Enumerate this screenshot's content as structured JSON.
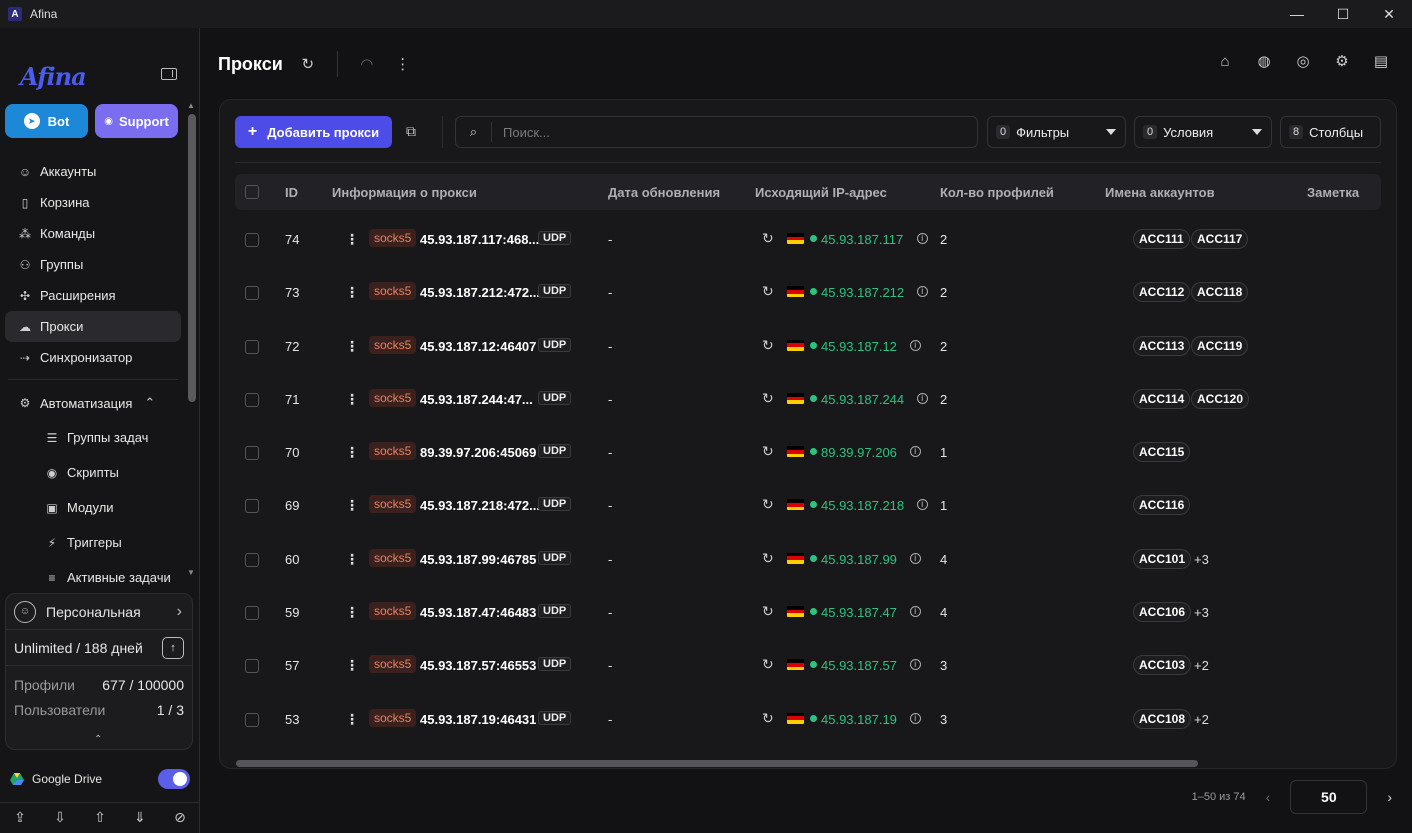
{
  "window": {
    "title": "Afina",
    "app_icon_letter": "A",
    "minimize": "—",
    "maximize": "☐",
    "close": "✕"
  },
  "brand": {
    "logo_text": "Afina"
  },
  "sidebar": {
    "bot_label": "Bot",
    "support_label": "Support",
    "items": [
      {
        "label": "Аккаунты",
        "icon": "user-circle-icon",
        "glyph": "☺"
      },
      {
        "label": "Корзина",
        "icon": "trash-icon",
        "glyph": "▯"
      },
      {
        "label": "Команды",
        "icon": "team-icon",
        "glyph": "⁂"
      },
      {
        "label": "Группы",
        "icon": "groups-icon",
        "glyph": "⚇"
      },
      {
        "label": "Расширения",
        "icon": "puzzle-icon",
        "glyph": "✣"
      },
      {
        "label": "Прокси",
        "icon": "cloud-icon",
        "glyph": "☁"
      },
      {
        "label": "Синхронизатор",
        "icon": "sync-icon",
        "glyph": "⇢"
      }
    ],
    "automation": {
      "label": "Автоматизация",
      "icon": "automation-icon",
      "glyph": "⚙",
      "chevron": "⌃"
    },
    "sub_items": [
      {
        "label": "Группы задач",
        "icon": "list-icon",
        "glyph": "☰"
      },
      {
        "label": "Скрипты",
        "icon": "github-icon",
        "glyph": "◉"
      },
      {
        "label": "Модули",
        "icon": "terminal-icon",
        "glyph": "▣"
      },
      {
        "label": "Триггеры",
        "icon": "bolt-icon",
        "glyph": "⚡"
      },
      {
        "label": "Активные задачи",
        "icon": "tasks-icon",
        "glyph": "≡"
      }
    ],
    "plan": {
      "name": "Персональная",
      "chevron": "›",
      "tier": "Unlimited / 188 дней",
      "upgrade_glyph": "↑",
      "profiles_label": "Профили",
      "profiles_value": "677 / 100000",
      "users_label": "Пользователи",
      "users_value": "1 / 3",
      "collapse_glyph": "⌃"
    },
    "gdrive_label": "Google Drive",
    "gdrive_enabled": true,
    "bottom_icons": [
      {
        "name": "cloud-upload-icon",
        "glyph": "⇪"
      },
      {
        "name": "cloud-download-icon",
        "glyph": "⇩"
      },
      {
        "name": "folder-upload-icon",
        "glyph": "⇧"
      },
      {
        "name": "folder-download-icon",
        "glyph": "⇓"
      },
      {
        "name": "eye-off-icon",
        "glyph": "⊘"
      }
    ]
  },
  "header": {
    "title": "Прокси",
    "refresh_glyph": "↻",
    "wifi_glyph": "◠",
    "more_glyph": "⋮",
    "right_icons": [
      {
        "name": "tag-icon",
        "glyph": "⌂"
      },
      {
        "name": "globe-lock-icon",
        "glyph": "◍"
      },
      {
        "name": "globe-icon",
        "glyph": "◎"
      },
      {
        "name": "settings-icon",
        "glyph": "⚙"
      },
      {
        "name": "layout-icon",
        "glyph": "▤"
      }
    ]
  },
  "toolbar": {
    "add_label": "Добавить прокси",
    "add_glyph": "+",
    "bulk_glyph": "⧉",
    "search_glyph": "⌕",
    "search_placeholder": "Поиск...",
    "filters_count": "0",
    "filters_label": "Фильтры",
    "conditions_count": "0",
    "conditions_label": "Условия",
    "columns_count": "8",
    "columns_label": "Столбцы"
  },
  "table": {
    "columns": {
      "id": "ID",
      "info": "Информация о прокси",
      "updated": "Дата обновления",
      "ip": "Исходящий IP-адрес",
      "profiles": "Кол-во профилей",
      "accounts": "Имена аккаунтов",
      "note": "Заметка"
    },
    "rows": [
      {
        "id": "74",
        "proto": "socks5",
        "addr": "45.93.187.117:468...",
        "udp": "UDP",
        "updated": "-",
        "ip": "45.93.187.117",
        "profiles": "2",
        "acc1": "ACC111",
        "acc2": "ACC117",
        "more": ""
      },
      {
        "id": "73",
        "proto": "socks5",
        "addr": "45.93.187.212:472...",
        "udp": "UDP",
        "updated": "-",
        "ip": "45.93.187.212",
        "profiles": "2",
        "acc1": "ACC112",
        "acc2": "ACC118",
        "more": ""
      },
      {
        "id": "72",
        "proto": "socks5",
        "addr": "45.93.187.12:46407",
        "udp": "UDP",
        "updated": "-",
        "ip": "45.93.187.12",
        "profiles": "2",
        "acc1": "ACC113",
        "acc2": "ACC119",
        "more": ""
      },
      {
        "id": "71",
        "proto": "socks5",
        "addr": "45.93.187.244:47...",
        "udp": "UDP",
        "updated": "-",
        "ip": "45.93.187.244",
        "profiles": "2",
        "acc1": "ACC114",
        "acc2": "ACC120",
        "more": ""
      },
      {
        "id": "70",
        "proto": "socks5",
        "addr": "89.39.97.206:45069",
        "udp": "UDP",
        "updated": "-",
        "ip": "89.39.97.206",
        "profiles": "1",
        "acc1": "ACC115",
        "acc2": "",
        "more": ""
      },
      {
        "id": "69",
        "proto": "socks5",
        "addr": "45.93.187.218:472...",
        "udp": "UDP",
        "updated": "-",
        "ip": "45.93.187.218",
        "profiles": "1",
        "acc1": "ACC116",
        "acc2": "",
        "more": ""
      },
      {
        "id": "60",
        "proto": "socks5",
        "addr": "45.93.187.99:46785",
        "udp": "UDP",
        "updated": "-",
        "ip": "45.93.187.99",
        "profiles": "4",
        "acc1": "ACC101",
        "acc2": "",
        "more": "+3"
      },
      {
        "id": "59",
        "proto": "socks5",
        "addr": "45.93.187.47:46483",
        "udp": "UDP",
        "updated": "-",
        "ip": "45.93.187.47",
        "profiles": "4",
        "acc1": "ACC106",
        "acc2": "",
        "more": "+3"
      },
      {
        "id": "57",
        "proto": "socks5",
        "addr": "45.93.187.57:46553",
        "udp": "UDP",
        "updated": "-",
        "ip": "45.93.187.57",
        "profiles": "3",
        "acc1": "ACC103",
        "acc2": "",
        "more": "+2"
      },
      {
        "id": "53",
        "proto": "socks5",
        "addr": "45.93.187.19:46431",
        "udp": "UDP",
        "updated": "-",
        "ip": "45.93.187.19",
        "profiles": "3",
        "acc1": "ACC108",
        "acc2": "",
        "more": "+2"
      }
    ],
    "row_kebab": "⋮",
    "row_refresh": "↻",
    "row_info": "i",
    "flag_colors": [
      "#000000",
      "#dd0000",
      "#ffce00"
    ],
    "ip_color": "#2ec27e"
  },
  "pagination": {
    "range": "1–50 из 74",
    "page_size": "50",
    "prev_glyph": "‹",
    "next_glyph": "›"
  },
  "colors": {
    "accent": "#4e4ce6",
    "bot": "#1e88d8",
    "support": "#7a6df0",
    "proto_text": "#e9825f"
  }
}
